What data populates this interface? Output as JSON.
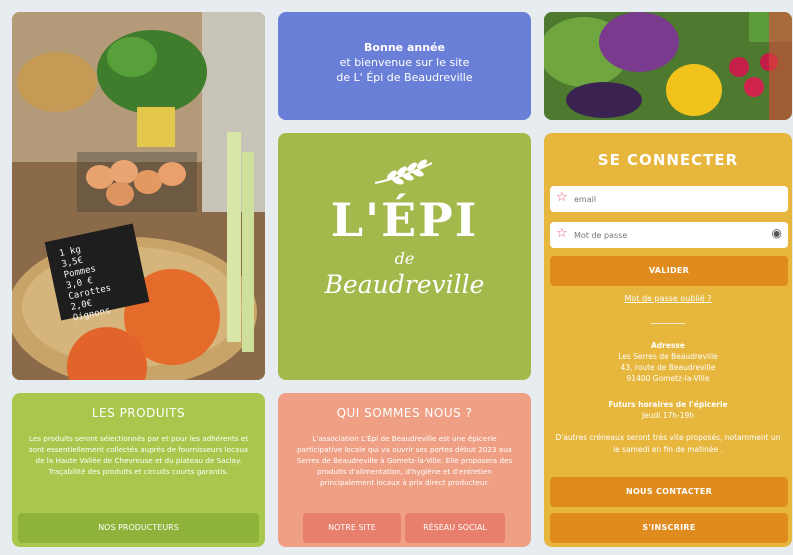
{
  "welcome": {
    "line1": "Bonne année",
    "line2": "et bienvenue sur le site",
    "line3": "de L' Épi de Beaudreville"
  },
  "brand": {
    "main": "L'ÉPI",
    "de": "de",
    "name": "Beaudreville"
  },
  "login": {
    "title": "SE CONNECTER",
    "email_placeholder": "email",
    "password_placeholder": "Mot de passe",
    "validate": "VALIDER",
    "forgot": "Mot de passe oublié ?",
    "address_title": "Adresse",
    "address_lines": [
      "Les Serres de Beaudreville",
      "43, route de Beaudreville",
      "91400 Gometz-la-Ville"
    ],
    "hours_title": "Futurs horaires de l'épicerie",
    "hours": "Jeudi 17h-19h",
    "note": "D'autres créneaux seront très vite proposés, notamment un le samedi en fin de matinée .",
    "contact": "NOUS CONTACTER",
    "signup": "S'INSCRIRE"
  },
  "products": {
    "title": "LES PRODUITS",
    "text": "Les produits seront sélectionnés par et pour les adhérents et sont essentiellement collectés auprès de fournisseurs locaux de la Haute Vallée de Chevreuse et du plateau de Saclay. Traçabilité des produits et circuits courts garantis.",
    "button": "NOS PRODUCTEURS"
  },
  "about": {
    "title": "QUI SOMMES NOUS ?",
    "text": "L'association L'Épi de Beaudreville est une épicerie participative locale qui va ouvrir ses portes début 2023 aux Serres de Beaudreville à Gometz-la-Ville. Elle proposera des produits d'alimentation, d'hygiène et d'entretien principalement locaux à prix direct producteur.",
    "button_site": "NOTRE SITE",
    "button_social": "RÉSEAU SOCIAL"
  },
  "photo_left_sign": [
    "1 kg",
    "3,5€",
    "Pommes",
    "3,0 €",
    "Carottes",
    "2,0€",
    "Oignons"
  ]
}
